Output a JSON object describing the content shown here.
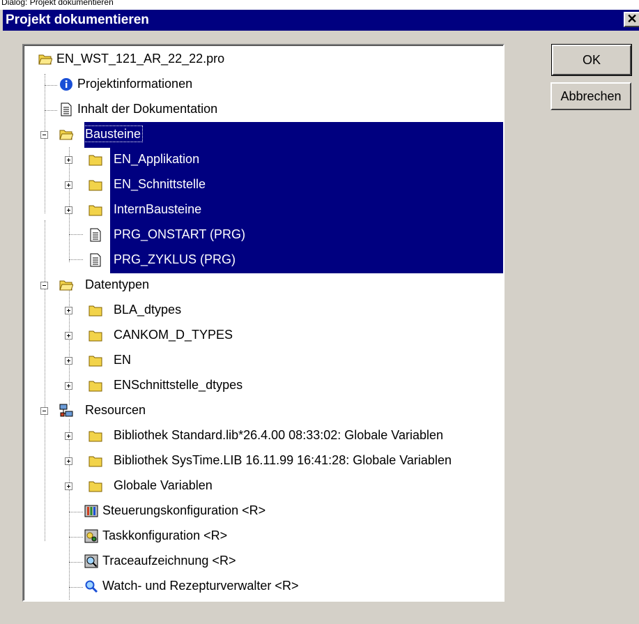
{
  "top_strip": "Dialog: Projekt dokumentieren",
  "dialog": {
    "title": "Projekt dokumentieren",
    "ok_label": "OK",
    "cancel_label": "Abbrechen"
  },
  "tree": {
    "root": "EN_WST_121_AR_22_22.pro",
    "projektinfo": "Projektinformationen",
    "inhalt": "Inhalt der Dokumentation",
    "bausteine": "Bausteine",
    "bausteine_children": [
      "EN_Applikation",
      "EN_Schnittstelle",
      "InternBausteine",
      "PRG_ONSTART (PRG)",
      "PRG_ZYKLUS (PRG)"
    ],
    "datentypen": "Datentypen",
    "datentypen_children": [
      "BLA_dtypes",
      "CANKOM_D_TYPES",
      "EN",
      "ENSchnittstelle_dtypes"
    ],
    "resourcen": "Resourcen",
    "resourcen_children": [
      "Bibliothek Standard.lib*26.4.00 08:33:02: Globale Variablen",
      "Bibliothek SysTime.LIB 16.11.99 16:41:28: Globale Variablen",
      "Globale Variablen",
      "Steuerungskonfiguration <R>",
      "Taskkonfiguration <R>",
      "Traceaufzeichnung <R>",
      "Watch- und Rezepturverwalter <R>"
    ]
  },
  "colors": {
    "selection": "#000080",
    "dialog_bg": "#d4d0c8",
    "folder": "#f2d34a"
  }
}
